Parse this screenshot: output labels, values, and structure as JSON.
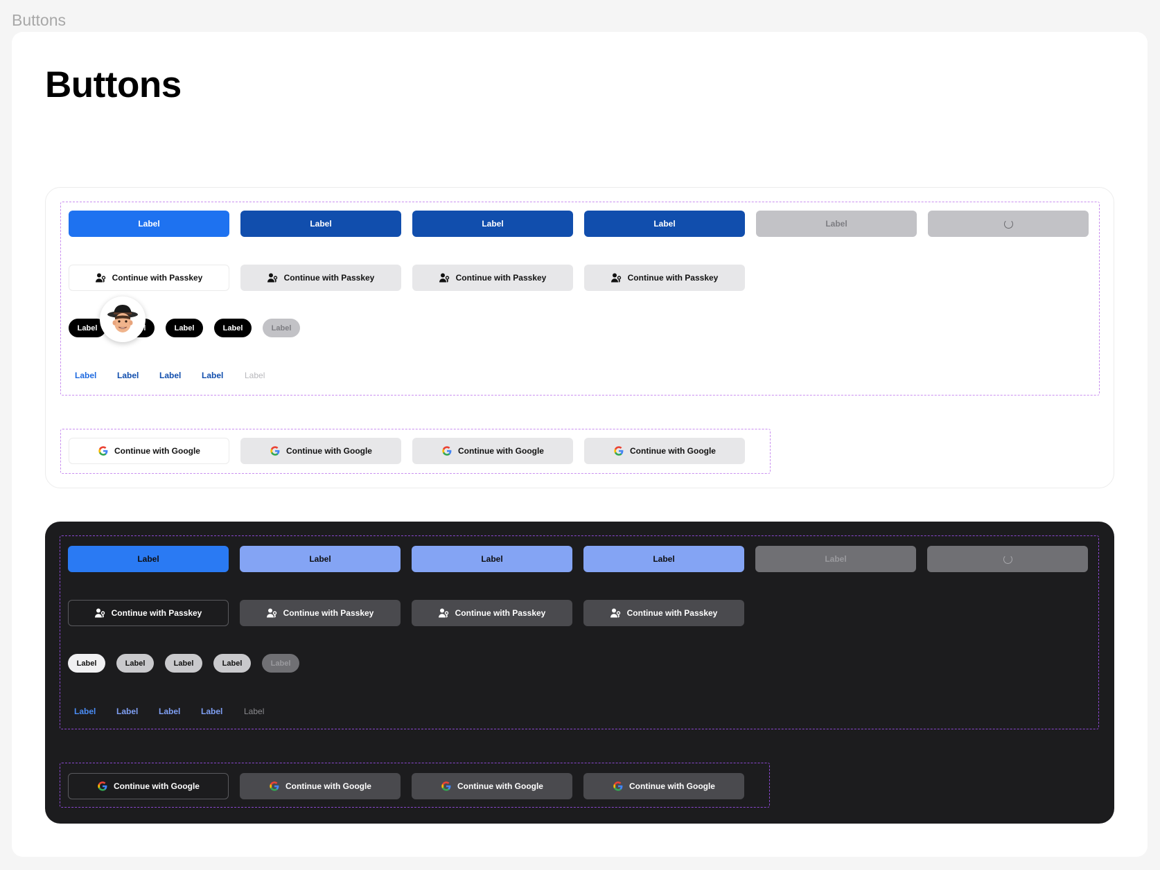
{
  "frame_label": "Buttons",
  "page_title": "Buttons",
  "light": {
    "primary_row": [
      "Label",
      "Label",
      "Label",
      "Label",
      "Label"
    ],
    "passkey_row": [
      "Continue with Passkey",
      "Continue with Passkey",
      "Continue with Passkey",
      "Continue with Passkey"
    ],
    "pill_row": [
      "Label",
      "Label",
      "Label",
      "Label",
      "Label"
    ],
    "link_row": [
      "Label",
      "Label",
      "Label",
      "Label",
      "Label"
    ],
    "google_row": [
      "Continue with Google",
      "Continue with Google",
      "Continue with Google",
      "Continue with Google"
    ]
  },
  "dark": {
    "primary_row": [
      "Label",
      "Label",
      "Label",
      "Label",
      "Label"
    ],
    "passkey_row": [
      "Continue with Passkey",
      "Continue with Passkey",
      "Continue with Passkey",
      "Continue with Passkey"
    ],
    "pill_row": [
      "Label",
      "Label",
      "Label",
      "Label",
      "Label"
    ],
    "link_row": [
      "Label",
      "Label",
      "Label",
      "Label",
      "Label"
    ],
    "google_row": [
      "Continue with Google",
      "Continue with Google",
      "Continue with Google",
      "Continue with Google"
    ]
  },
  "icons": {
    "passkey": "person-key-icon",
    "google": "google-g-icon",
    "loading": "spinner-icon",
    "avatar": "memoji-avatar"
  },
  "colors": {
    "primary": "#1e72f0",
    "primary_pressed": "#114ead",
    "dark_primary_pressed": "#84a4f4",
    "dashed_border": "#c98ef0",
    "dark_bg": "#1c1c1e"
  }
}
